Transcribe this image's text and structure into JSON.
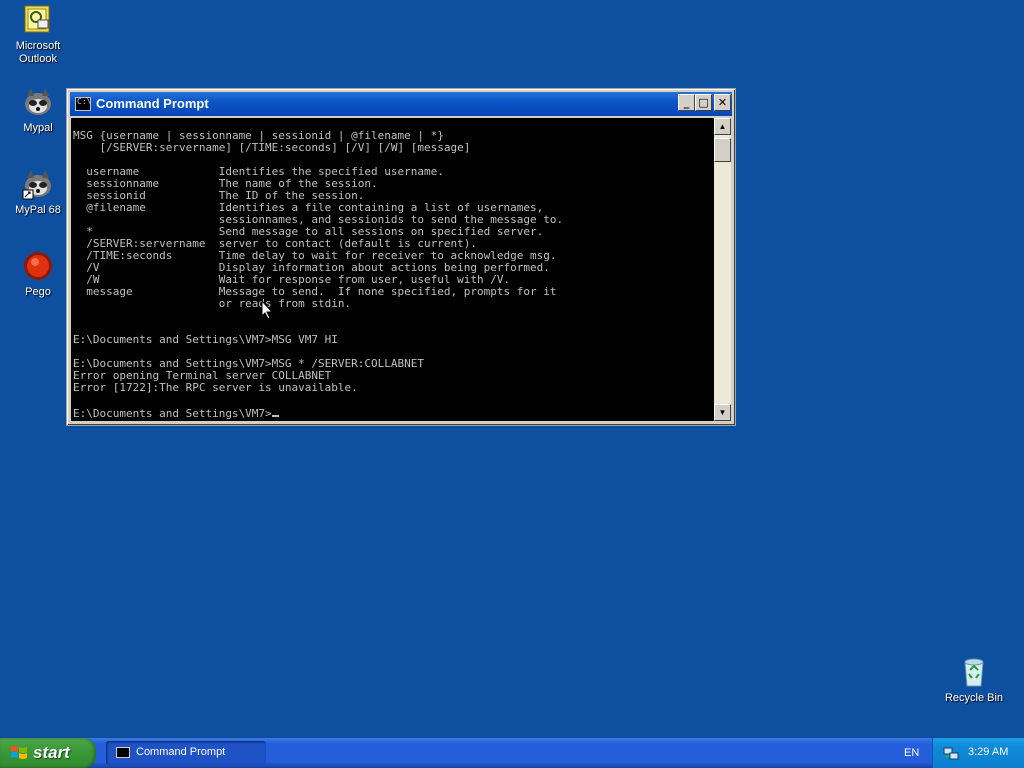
{
  "desktop": {
    "background": "#0f4fa0",
    "icons": [
      {
        "label": "Microsoft Outlook",
        "icon": "outlook-icon"
      },
      {
        "label": "Mypal",
        "icon": "mypal-icon"
      },
      {
        "label": "MyPal 68",
        "icon": "mypal68-icon"
      },
      {
        "label": "Pego",
        "icon": "pego-icon"
      },
      {
        "label": "Recycle Bin",
        "icon": "recycle-bin-icon"
      }
    ]
  },
  "window": {
    "title": "Command Prompt",
    "app_icon_text": "C:\\",
    "buttons": {
      "minimize": "_",
      "maximize": "□",
      "close": "✕"
    },
    "console_lines": [
      "MSG {username | sessionname | sessionid | @filename | *}",
      "    [/SERVER:servername] [/TIME:seconds] [/V] [/W] [message]",
      "",
      "  username            Identifies the specified username.",
      "  sessionname         The name of the session.",
      "  sessionid           The ID of the session.",
      "  @filename           Identifies a file containing a list of usernames,",
      "                      sessionnames, and sessionids to send the message to.",
      "  *                   Send message to all sessions on specified server.",
      "  /SERVER:servername  server to contact (default is current).",
      "  /TIME:seconds       Time delay to wait for receiver to acknowledge msg.",
      "  /V                  Display information about actions being performed.",
      "  /W                  Wait for response from user, useful with /V.",
      "  message             Message to send.  If none specified, prompts for it",
      "                      or reads from stdin.",
      "",
      "",
      "E:\\Documents and Settings\\VM7>MSG VM7 HI",
      "",
      "E:\\Documents and Settings\\VM7>MSG * /SERVER:COLLABNET",
      "Error opening Terminal server COLLABNET",
      "Error [1722]:The RPC server is unavailable.",
      "",
      "E:\\Documents and Settings\\VM7>"
    ],
    "scroll": {
      "up": "▲",
      "down": "▼"
    }
  },
  "taskbar": {
    "start_label": "start",
    "tasks": [
      {
        "label": "Command Prompt"
      }
    ],
    "language": "EN",
    "clock": "3:29 AM"
  }
}
